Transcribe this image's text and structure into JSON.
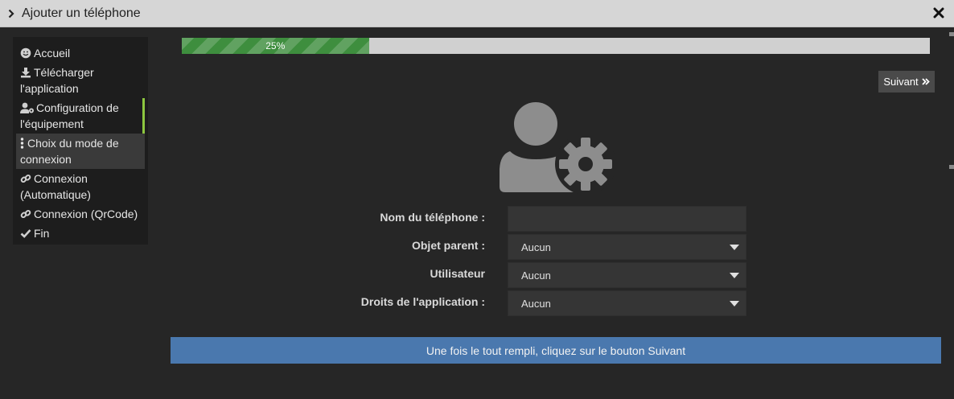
{
  "window": {
    "title": "Ajouter un téléphone"
  },
  "sidebar": {
    "items": [
      {
        "label": "Accueil",
        "icon": "smile-icon"
      },
      {
        "label": "Télécharger l'application",
        "icon": "download-icon"
      },
      {
        "label": "Configuration de l'équipement",
        "icon": "user-gear-icon"
      },
      {
        "label": "Choix du mode de connexion",
        "icon": "ellipsis-vertical-icon"
      },
      {
        "label": "Connexion (Automatique)",
        "icon": "link-icon"
      },
      {
        "label": "Connexion (QrCode)",
        "icon": "link-icon"
      },
      {
        "label": "Fin",
        "icon": "check-icon"
      }
    ],
    "active_index": 3
  },
  "progress": {
    "value": 25,
    "label": "25%"
  },
  "toolbar": {
    "next_label": "Suivant"
  },
  "form": {
    "phone_name": {
      "label": "Nom du téléphone :",
      "value": ""
    },
    "parent_object": {
      "label": "Objet parent :",
      "value": "Aucun"
    },
    "user": {
      "label": "Utilisateur",
      "value": "Aucun"
    },
    "app_rights": {
      "label": "Droits de l'application :",
      "value": "Aucun"
    }
  },
  "banner": {
    "text": "Une fois le tout rempli, cliquez sur le bouton Suivant"
  },
  "colors": {
    "progress_fill": "#3e8e3e",
    "banner": "#4a78ae",
    "done_marker": "#8dc63f",
    "titlebar": "#d6d6d6"
  }
}
